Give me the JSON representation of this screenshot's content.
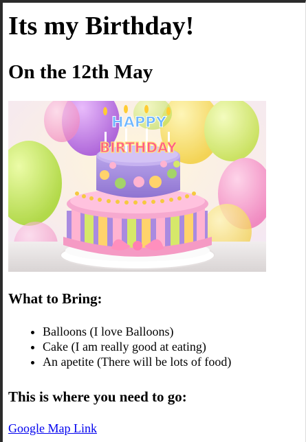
{
  "page": {
    "title": "Its my Birthday!",
    "subtitle": "On the 12th May"
  },
  "image": {
    "cake_text_happy": "HAPPY",
    "cake_text_birthday": "BIRTHDAY"
  },
  "bring": {
    "heading": "What to Bring:",
    "items": [
      "Balloons (I love Balloons)",
      "Cake (I am really good at eating)",
      "An apetite (There will be lots of food)"
    ]
  },
  "directions": {
    "heading": "This is where you need to go:",
    "link_text": "Google Map Link"
  },
  "colors": {
    "link": "#0000ee"
  }
}
